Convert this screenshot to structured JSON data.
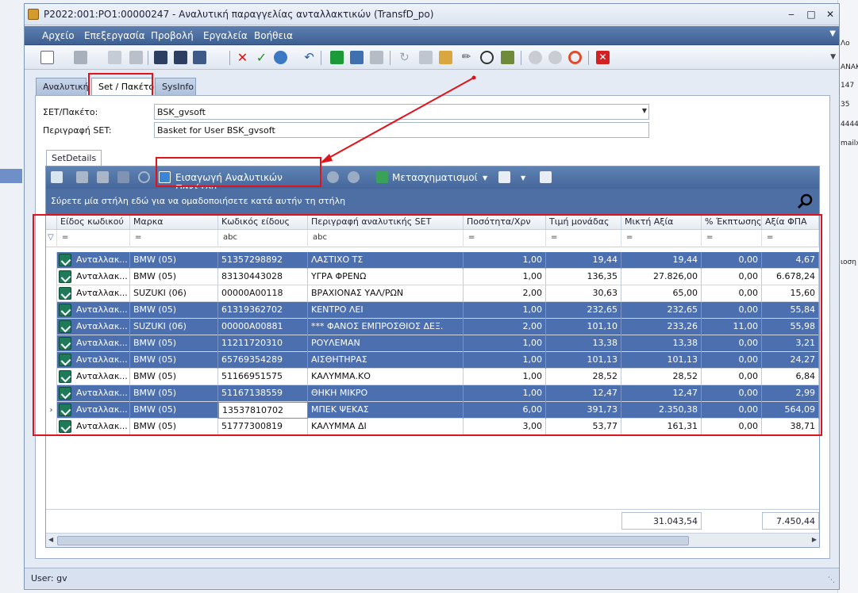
{
  "background": {
    "right_texts": [
      "Λο",
      "ANAK",
      "147",
      "35",
      "4444",
      "mailx",
      "ιοση"
    ],
    "top_right_label": "3>"
  },
  "window": {
    "title": "P2022:001:PO1:00000247 - Αναλυτική παραγγελίας ανταλλακτικών (TransfD_po)",
    "minimize": "‒",
    "maximize": "□",
    "close": "✕"
  },
  "menu": [
    "Αρχείο",
    "Επεξεργασία",
    "Προβολή",
    "Εργαλεία",
    "Βοήθεια"
  ],
  "tabs": [
    "Αναλυτική",
    "Set / Πακέτο",
    "SysInfo"
  ],
  "active_tab": "Set / Πακέτο",
  "form": {
    "set_label": "ΣΕΤ/Πακέτο:",
    "set_value": "BSK_gvsoft",
    "desc_label": "Περιγραφή SET:",
    "desc_value": "Basket for User BSK_gvsoft"
  },
  "subtab": "SetDetails",
  "grid_toolbar": {
    "import_label": "Εισαγωγή Αναλυτικών Πακέτου",
    "transform_label": "Μετασχηματισμοί"
  },
  "group_hint": "Σύρετε μία στήλη εδώ για να ομαδοποιήσετε κατά αυτήν τη στήλη",
  "columns": [
    "Είδος κωδικού",
    "Μαρκα",
    "Κωδικός είδους",
    "Περιγραφή αναλυτικής SET",
    "Ποσότητα/Χρν",
    "Τιμή μονάδας",
    "Μικτή Αξία",
    "% Έκπτωσης",
    "Αξία ΦΠΑ"
  ],
  "filters": [
    "=",
    "=",
    "abc",
    "abc",
    "=",
    "=",
    "=",
    "=",
    "="
  ],
  "rows": [
    {
      "type": "Ανταλλακ...",
      "brand": "BMW (05)",
      "code": "51357298892",
      "desc": "ΛΑΣΤΙΧΟ ΤΣ",
      "qty": "1,00",
      "price": "19,44",
      "gross": "19,44",
      "disc": "0,00",
      "vat": "4,67",
      "selected": true
    },
    {
      "type": "Ανταλλακ...",
      "brand": "BMW (05)",
      "code": "83130443028",
      "desc": "ΥΓΡΑ ΦΡΕΝΩ",
      "qty": "1,00",
      "price": "136,35",
      "gross": "27.826,00",
      "disc": "0,00",
      "vat": "6.678,24",
      "selected": false
    },
    {
      "type": "Ανταλλακ...",
      "brand": "SUZUKI (06)",
      "code": "00000A00118",
      "desc": "ΒΡΑΧΙΟΝΑΣ ΥΑΛ/ΡΩΝ",
      "qty": "2,00",
      "price": "30,63",
      "gross": "65,00",
      "disc": "0,00",
      "vat": "15,60",
      "selected": false
    },
    {
      "type": "Ανταλλακ...",
      "brand": "BMW (05)",
      "code": "61319362702",
      "desc": "ΚΕΝΤΡΟ ΛΕΙ",
      "qty": "1,00",
      "price": "232,65",
      "gross": "232,65",
      "disc": "0,00",
      "vat": "55,84",
      "selected": true
    },
    {
      "type": "Ανταλλακ...",
      "brand": "SUZUKI (06)",
      "code": "00000A00881",
      "desc": "*** ΦΑΝΟΣ ΕΜΠΡΟΣΘΙΟΣ ΔΕΞ.",
      "qty": "2,00",
      "price": "101,10",
      "gross": "233,26",
      "disc": "11,00",
      "vat": "55,98",
      "selected": true
    },
    {
      "type": "Ανταλλακ...",
      "brand": "BMW (05)",
      "code": "11211720310",
      "desc": "ΡΟΥΛΕΜΑΝ",
      "qty": "1,00",
      "price": "13,38",
      "gross": "13,38",
      "disc": "0,00",
      "vat": "3,21",
      "selected": true
    },
    {
      "type": "Ανταλλακ...",
      "brand": "BMW (05)",
      "code": "65769354289",
      "desc": "ΑΙΣΘΗΤΗΡΑΣ",
      "qty": "1,00",
      "price": "101,13",
      "gross": "101,13",
      "disc": "0,00",
      "vat": "24,27",
      "selected": true
    },
    {
      "type": "Ανταλλακ...",
      "brand": "BMW (05)",
      "code": "51166951575",
      "desc": "ΚΑΛΥΜΜΑ.ΚΟ",
      "qty": "1,00",
      "price": "28,52",
      "gross": "28,52",
      "disc": "0,00",
      "vat": "6,84",
      "selected": false
    },
    {
      "type": "Ανταλλακ...",
      "brand": "BMW (05)",
      "code": "51167138559",
      "desc": "ΘΗΚΗ ΜΙΚΡΟ",
      "qty": "1,00",
      "price": "12,47",
      "gross": "12,47",
      "disc": "0,00",
      "vat": "2,99",
      "selected": true
    },
    {
      "type": "Ανταλλακ...",
      "brand": "BMW (05)",
      "code": "13537810702",
      "desc": "ΜΠΕΚ ΨΕΚΑΣ",
      "qty": "6,00",
      "price": "391,73",
      "gross": "2.350,38",
      "disc": "0,00",
      "vat": "564,09",
      "selected": true,
      "current": true
    },
    {
      "type": "Ανταλλακ...",
      "brand": "BMW (05)",
      "code": "51777300819",
      "desc": "ΚΑΛΥΜΜΑ ΔΙ",
      "qty": "3,00",
      "price": "53,77",
      "gross": "161,31",
      "disc": "0,00",
      "vat": "38,71",
      "selected": false
    }
  ],
  "totals": {
    "gross": "31.043,54",
    "vat": "7.450,44"
  },
  "status": "User: gv",
  "colors": {
    "selected_row": "#4c6fb0",
    "menubar": "#4e6fa3",
    "highlight": "#e0121b"
  }
}
